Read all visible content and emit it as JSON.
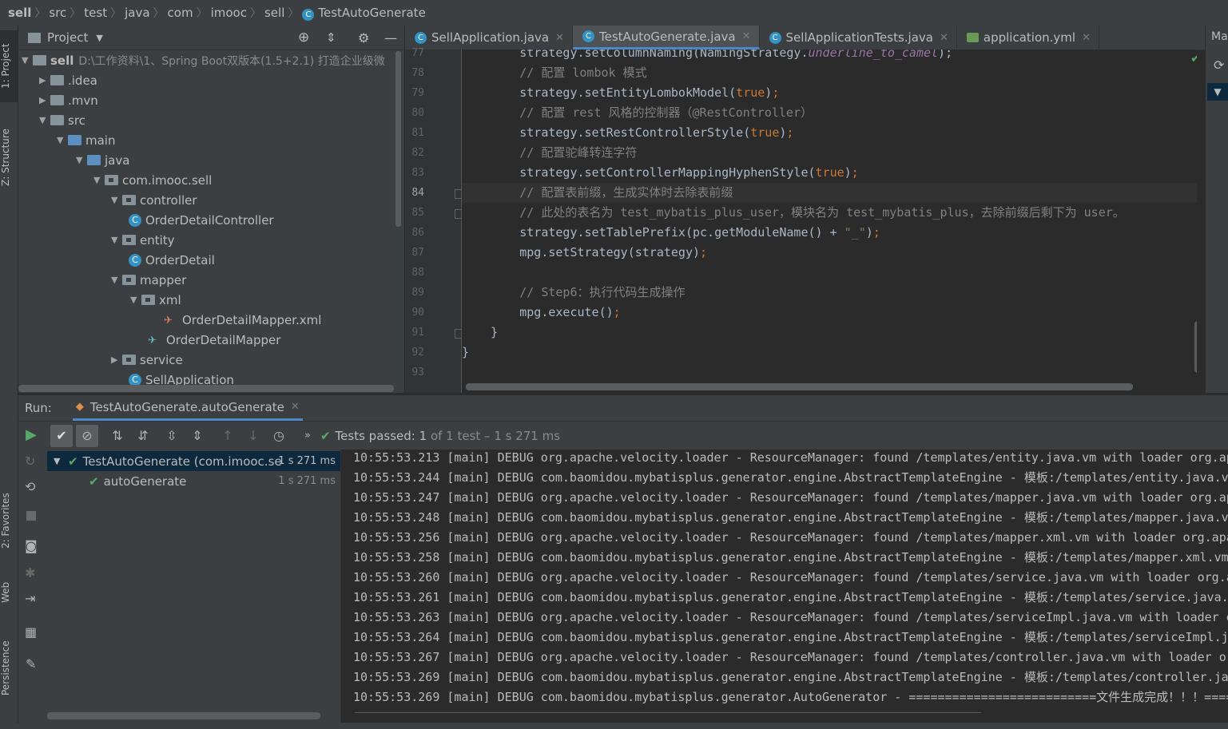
{
  "breadcrumb": [
    "sell",
    "src",
    "test",
    "java",
    "com",
    "imooc",
    "sell",
    "TestAutoGenerate"
  ],
  "left_strip": {
    "project": "1: Project",
    "structure": "Z: Structure",
    "favorites": "2: Favorites",
    "web": "Web",
    "persistence": "Persistence"
  },
  "project_panel": {
    "title": "Project",
    "root_name": "sell",
    "root_path": "D:\\工作资料\\1、Spring Boot双版本(1.5+2.1) 打造企业级微",
    "tree": [
      {
        "label": ".idea",
        "arrow": "▶",
        "kind": "folder"
      },
      {
        "label": ".mvn",
        "arrow": "▶",
        "kind": "folder"
      },
      {
        "label": "src",
        "arrow": "▼",
        "kind": "folder"
      },
      {
        "label": "main",
        "arrow": "▼",
        "kind": "folder-blue"
      },
      {
        "label": "java",
        "arrow": "▼",
        "kind": "folder-blue"
      },
      {
        "label": "com.imooc.sell",
        "arrow": "▼",
        "kind": "package"
      },
      {
        "label": "controller",
        "arrow": "▼",
        "kind": "package"
      },
      {
        "label": "OrderDetailController",
        "arrow": "",
        "kind": "class"
      },
      {
        "label": "entity",
        "arrow": "▼",
        "kind": "package"
      },
      {
        "label": "OrderDetail",
        "arrow": "",
        "kind": "class"
      },
      {
        "label": "mapper",
        "arrow": "▼",
        "kind": "package"
      },
      {
        "label": "xml",
        "arrow": "▼",
        "kind": "package"
      },
      {
        "label": "OrderDetailMapper.xml",
        "arrow": "",
        "kind": "xml"
      },
      {
        "label": "OrderDetailMapper",
        "arrow": "",
        "kind": "mapper"
      },
      {
        "label": "service",
        "arrow": "▶",
        "kind": "package"
      },
      {
        "label": "SellApplication",
        "arrow": "",
        "kind": "class"
      }
    ]
  },
  "editor_tabs": [
    {
      "label": "SellApplication.java",
      "active": false
    },
    {
      "label": "TestAutoGenerate.java",
      "active": true
    },
    {
      "label": "SellApplicationTests.java",
      "active": false
    },
    {
      "label": "application.yml",
      "active": false
    }
  ],
  "right_strip_label": "Ma",
  "code": {
    "first_line": 77,
    "current_line": 84,
    "line_numbers": [
      "77",
      "78",
      "79",
      "80",
      "81",
      "82",
      "83",
      "84",
      "85",
      "86",
      "87",
      "88",
      "89",
      "90",
      "91",
      "92",
      "93"
    ]
  },
  "run": {
    "label": "Run:",
    "tab_label": "TestAutoGenerate.autoGenerate",
    "status_prefix": "Tests passed:",
    "status_count": "1",
    "status_rest": "of 1 test – 1 s 271 ms",
    "tree": [
      {
        "label": "TestAutoGenerate (com.imooc.se",
        "time": "1 s 271 ms",
        "selected": true
      },
      {
        "label": "autoGenerate",
        "time": "1 s 271 ms",
        "selected": false
      }
    ],
    "log": [
      "10:55:53.213 [main] DEBUG org.apache.velocity.loader - ResourceManager: found /templates/entity.java.vm with loader org.apache",
      "10:55:53.244 [main] DEBUG com.baomidou.mybatisplus.generator.engine.AbstractTemplateEngine - 模板:/templates/entity.java.vm",
      "10:55:53.247 [main] DEBUG org.apache.velocity.loader - ResourceManager: found /templates/mapper.java.vm with loader org.apache",
      "10:55:53.248 [main] DEBUG com.baomidou.mybatisplus.generator.engine.AbstractTemplateEngine - 模板:/templates/mapper.java.vm",
      "10:55:53.256 [main] DEBUG org.apache.velocity.loader - ResourceManager: found /templates/mapper.xml.vm with loader org.apache",
      "10:55:53.258 [main] DEBUG com.baomidou.mybatisplus.generator.engine.AbstractTemplateEngine - 模板:/templates/mapper.xml.vm",
      "10:55:53.260 [main] DEBUG org.apache.velocity.loader - ResourceManager: found /templates/service.java.vm with loader org.apache",
      "10:55:53.261 [main] DEBUG com.baomidou.mybatisplus.generator.engine.AbstractTemplateEngine - 模板:/templates/service.java.vm",
      "10:55:53.263 [main] DEBUG org.apache.velocity.loader - ResourceManager: found /templates/serviceImpl.java.vm with loader org.",
      "10:55:53.264 [main] DEBUG com.baomidou.mybatisplus.generator.engine.AbstractTemplateEngine - 模板:/templates/serviceImpl.java",
      "10:55:53.267 [main] DEBUG org.apache.velocity.loader - ResourceManager: found /templates/controller.java.vm with loader org.",
      "10:55:53.269 [main] DEBUG com.baomidou.mybatisplus.generator.engine.AbstractTemplateEngine - 模板:/templates/controller.java",
      "10:55:53.269 [main] DEBUG com.baomidou.mybatisplus.generator.AutoGenerator - ==========================文件生成完成！！！===="
    ]
  },
  "colors": {
    "accent": "#4a88c7",
    "pass": "#59a869",
    "selection": "#0d293e"
  }
}
